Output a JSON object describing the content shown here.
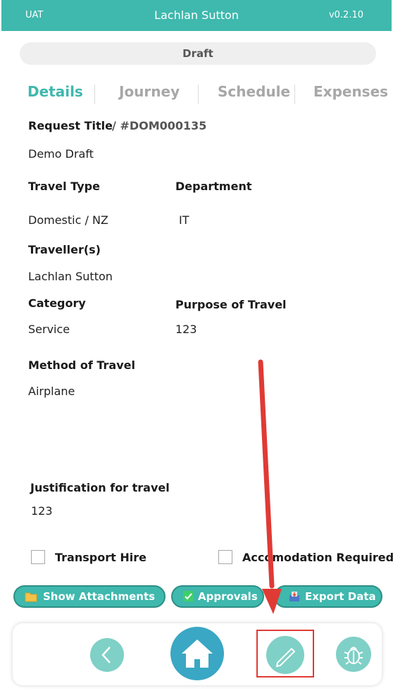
{
  "header": {
    "env": "UAT",
    "user": "Lachlan Sutton",
    "version": "v0.2.10"
  },
  "status": "Draft",
  "tabs": [
    "Details",
    "Journey",
    "Schedule",
    "Expenses"
  ],
  "details": {
    "request_title_label": "Request Title",
    "request_id": "/ #DOM000135",
    "request_title_value": "Demo Draft",
    "travel_type_label": "Travel Type",
    "travel_type_value": "Domestic / NZ",
    "department_label": "Department",
    "department_value": "IT",
    "travellers_label": "Traveller(s)",
    "travellers_value": "Lachlan Sutton",
    "category_label": "Category",
    "category_value": "Service",
    "purpose_label": "Purpose of Travel",
    "purpose_value": "123",
    "method_label": "Method of Travel",
    "method_value": "Airplane",
    "justification_label": "Justification for travel",
    "justification_value": "123"
  },
  "checkboxes": {
    "transport_hire": {
      "label": "Transport Hire",
      "checked": false
    },
    "accommodation": {
      "label": "Accomodation Required",
      "checked": false
    }
  },
  "actions": {
    "attachments": "Show Attachments",
    "approvals": "Approvals",
    "export": "Export Data"
  },
  "nav_icons": [
    "back-icon",
    "home-icon",
    "edit-pencil-icon",
    "bug-icon"
  ],
  "colors": {
    "accent": "#3fb8ad",
    "annotation": "#e03a35"
  }
}
